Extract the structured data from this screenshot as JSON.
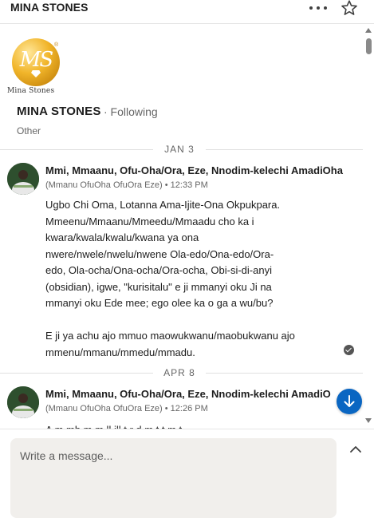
{
  "header": {
    "title": "MINA STONES"
  },
  "company": {
    "logo_text": "MS",
    "logo_caption": "Mina Stones",
    "name": "MINA STONES",
    "following": "· Following",
    "category": "Other"
  },
  "messages": [
    {
      "date": "JAN 3",
      "sender": "Mmi, Mmaanu, Ofu-Oha/Ora, Eze, Nnodim-kelechi AmadiOha",
      "meta": "(Mmanu OfuOha OfuOra Eze) • 12:33 PM",
      "paragraph1_lines": [
        "Ugbo Chi Oma, Lotanna Ama-Ijite-Ona Okpukpara.",
        "Mmeenu/Mmaanu/Mmeedu/Mmaadu cho ka i",
        "kwara/kwala/kwalu/kwana ya ona",
        "nwere/nwele/nwelu/nwene Ola-edo/Ona-edo/Ora-",
        "edo, Ola-ocha/Ona-ocha/Ora-ocha, Obi-si-di-anyi",
        "(obsidian), igwe, \"kurisitalu\" e ji mmanyi oku Ji na",
        "mmanyi oku Ede mee; ego olee ka o ga a wu/bu?"
      ],
      "paragraph2_lines": [
        "E ji ya achu ajo mmuo maowukwanu/maobukwanu ajo",
        "mmenu/mmanu/mmedu/mmadu."
      ],
      "status": "read"
    },
    {
      "date": "APR 8",
      "sender": "Mmi, Mmaanu, Ofu-Oha/Ora, Eze, Nnodim-kelechi AmadiO",
      "meta": "(Mmanu OfuOha OfuOra Eze) • 12:26 PM",
      "preview": "A    m    mb  m  m  ll   ill    t  r  d  m    t  t  m    t"
    }
  ],
  "compose": {
    "placeholder": "Write a message..."
  },
  "icons": {
    "more": "more-icon",
    "star": "star-icon",
    "read_receipt": "check-circle-icon",
    "jump_to_latest": "arrow-down-icon",
    "expand": "chevron-up-icon"
  },
  "colors": {
    "accent": "#0a66c2",
    "logo_gold": "#f1b52a",
    "compose_bg": "#f1efec"
  }
}
